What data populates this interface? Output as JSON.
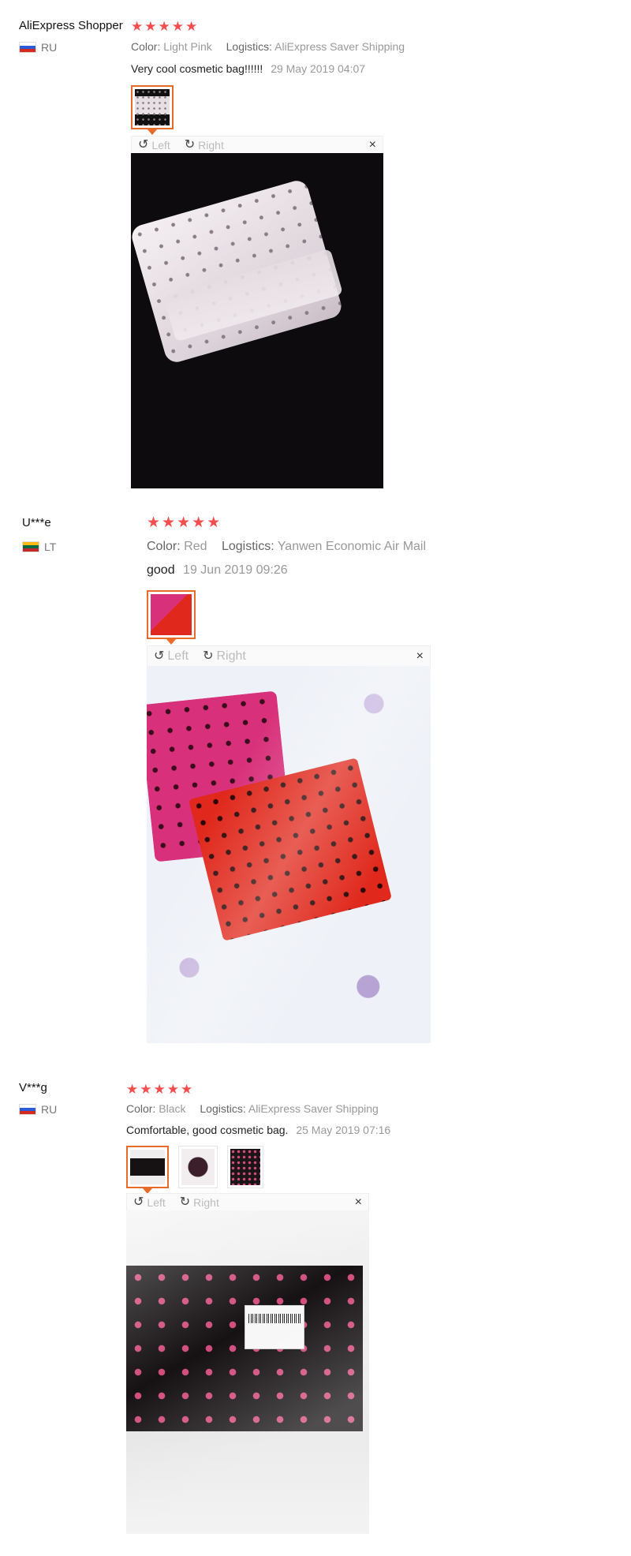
{
  "reviews": [
    {
      "user": "AliExpress Shopper",
      "country": "RU",
      "stars": 5,
      "color_label": "Color:",
      "color_value": "Light Pink",
      "logistics_label": "Logistics:",
      "logistics_value": "AliExpress Saver Shipping",
      "text": "Very cool cosmetic bag!!!!!!",
      "date": "29 May 2019 04:07",
      "viewer": {
        "left": "Left",
        "right": "Right",
        "close": "×"
      }
    },
    {
      "user": "U***e",
      "country": "LT",
      "stars": 5,
      "color_label": "Color:",
      "color_value": "Red",
      "logistics_label": "Logistics:",
      "logistics_value": "Yanwen Economic Air Mail",
      "text": "good",
      "date": "19 Jun 2019 09:26",
      "viewer": {
        "left": "Left",
        "right": "Right",
        "close": "×"
      }
    },
    {
      "user": "V***g",
      "country": "RU",
      "stars": 5,
      "color_label": "Color:",
      "color_value": "Black",
      "logistics_label": "Logistics:",
      "logistics_value": "AliExpress Saver Shipping",
      "text": "Comfortable, good cosmetic bag.",
      "date": "25 May 2019 07:16",
      "viewer": {
        "left": "Left",
        "right": "Right",
        "close": "×"
      }
    }
  ],
  "icons": {
    "star": "star-icon",
    "rotate_left": "rotate-left-icon",
    "rotate_right": "rotate-right-icon",
    "close": "close-icon"
  },
  "colors": {
    "star": "#f44d4d",
    "active_thumb": "#e86b2a"
  }
}
